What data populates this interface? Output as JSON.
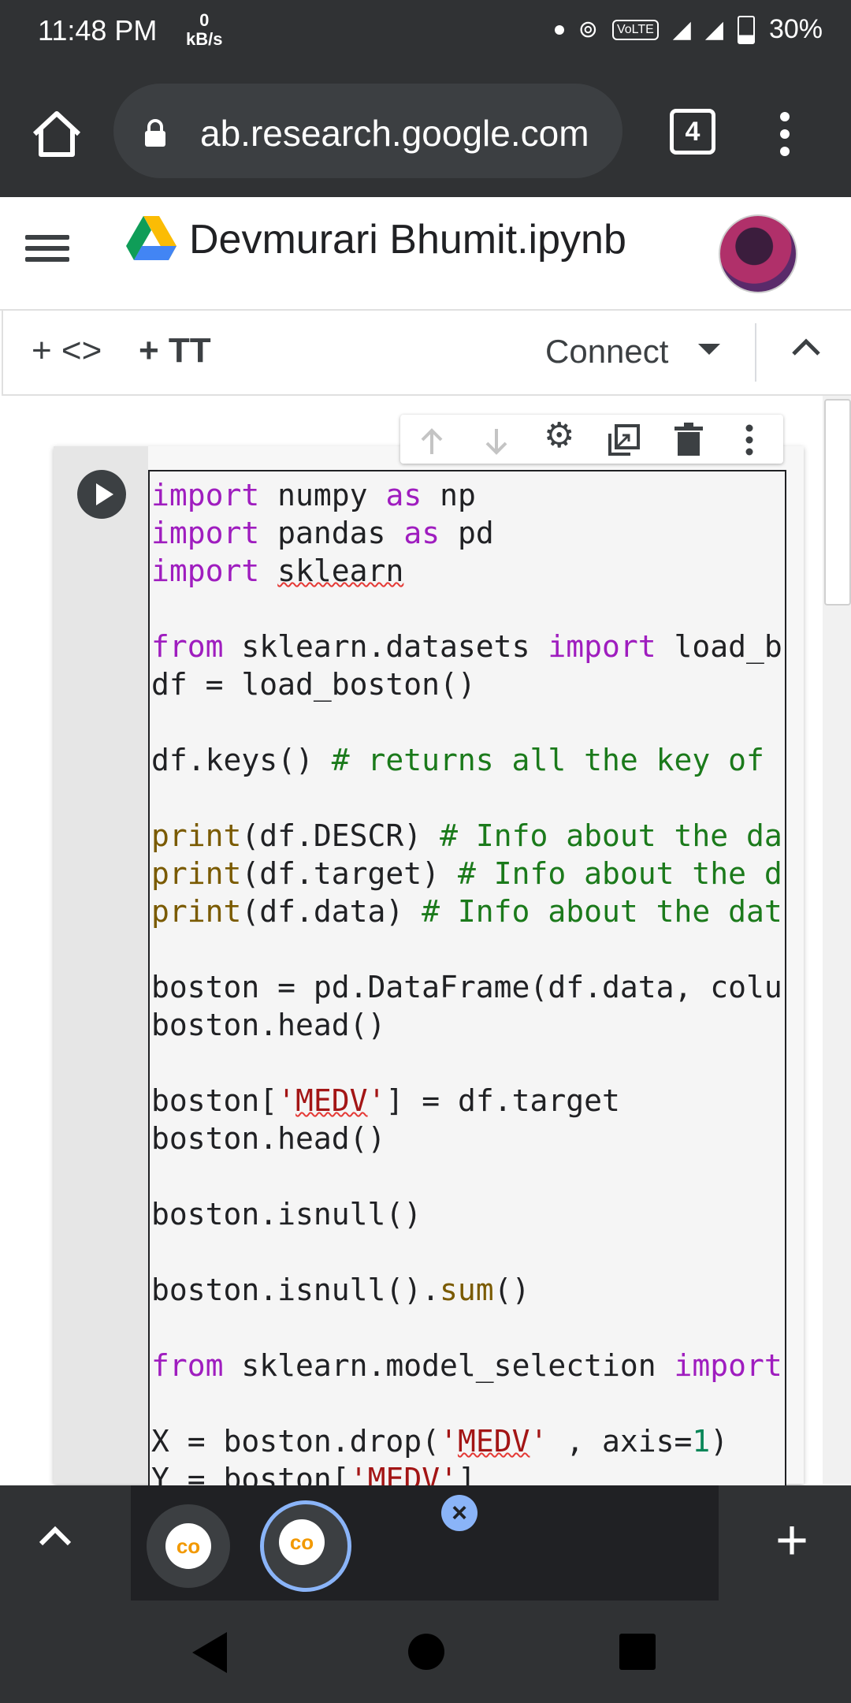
{
  "status_bar": {
    "time": "11:48 PM",
    "speed_value": "0",
    "speed_unit": "kB/s",
    "network": "VoLTE",
    "battery": "30%"
  },
  "browser": {
    "url": "ab.research.google.com",
    "tab_count": "4"
  },
  "header": {
    "title": "Devmurari Bhumit.ipynb"
  },
  "toolbar": {
    "add_code_label": "+ <>",
    "add_text_label": "+ TT",
    "connect_label": "Connect"
  },
  "cell_toolbar": {
    "icons": [
      "arrow-up-icon",
      "arrow-down-icon",
      "gear-icon",
      "mirror-cell-icon",
      "trash-icon",
      "more-vert-icon"
    ]
  },
  "code_lines": [
    "import numpy as np",
    "import pandas as pd",
    "import sklearn",
    "",
    "from sklearn.datasets import load_b",
    "df = load_boston()",
    "",
    "df.keys() # returns all the key of",
    "",
    "print(df.DESCR) # Info about the da",
    "print(df.target) # Info about the d",
    "print(df.data) # Info about the dat",
    "",
    "boston = pd.DataFrame(df.data, colu",
    "boston.head()",
    "",
    "boston['MEDV'] = df.target",
    "boston.head()",
    "",
    "boston.isnull()",
    "",
    "boston.isnull().sum()",
    "",
    "from sklearn.model_selection import",
    "",
    "X = boston.drop('MEDV' , axis=1)",
    "Y = boston['MEDV']"
  ],
  "tabs": {
    "logo_text": "co"
  }
}
